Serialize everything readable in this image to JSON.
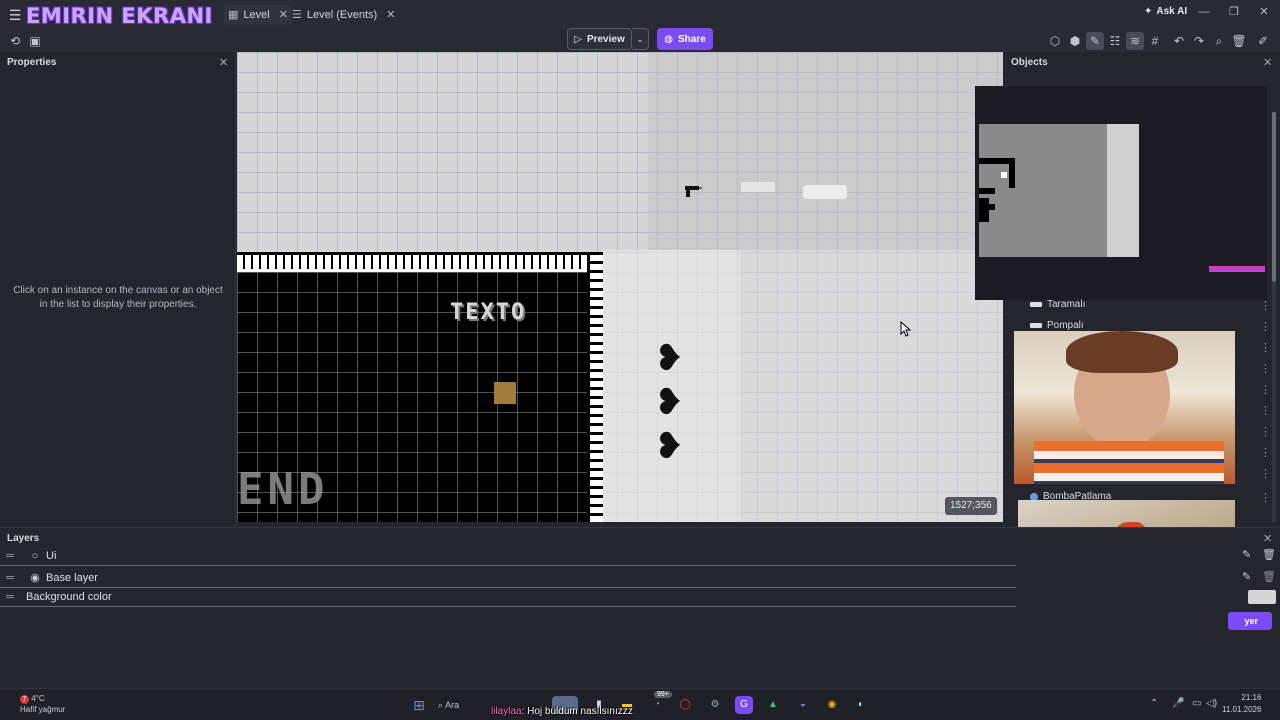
{
  "window": {
    "stream_title": "EMIRIN EKRANI",
    "tabs": [
      {
        "label": "Level",
        "icon": "grid-icon",
        "active": true
      },
      {
        "label": "Level (Events)",
        "icon": "list-icon",
        "active": false
      }
    ],
    "ask_ai": "Ask AI"
  },
  "toolbar": {
    "preview_label": "Preview",
    "share_label": "Share",
    "accent": "#7b4cf5"
  },
  "properties": {
    "title": "Properties",
    "hint": "Click on an instance on the canvas or an object in the list to display their properties."
  },
  "canvas": {
    "text_object": "TEXTO",
    "end_text": "END",
    "coordinates": "1527;356"
  },
  "objects": {
    "title": "Objects",
    "items": [
      {
        "label": "Taramalı"
      },
      {
        "label": "Pompalı"
      },
      {
        "label": "BombaPatlama"
      }
    ]
  },
  "layers": {
    "title": "Layers",
    "rows": [
      {
        "label": "Ui"
      },
      {
        "label": "Base layer"
      },
      {
        "label": "Background color"
      }
    ],
    "add_label": "yer"
  },
  "taskbar": {
    "weather_temp": "4°C",
    "weather_desc": "Hafif yağmur",
    "weather_badge": "7",
    "search_placeholder": "Ara",
    "notif_badge": "99+",
    "time": "21:16",
    "date": "11.01.2026"
  },
  "chat": {
    "user": "lilaylaa",
    "message": "Hoj buldum nasılsınızzz"
  }
}
